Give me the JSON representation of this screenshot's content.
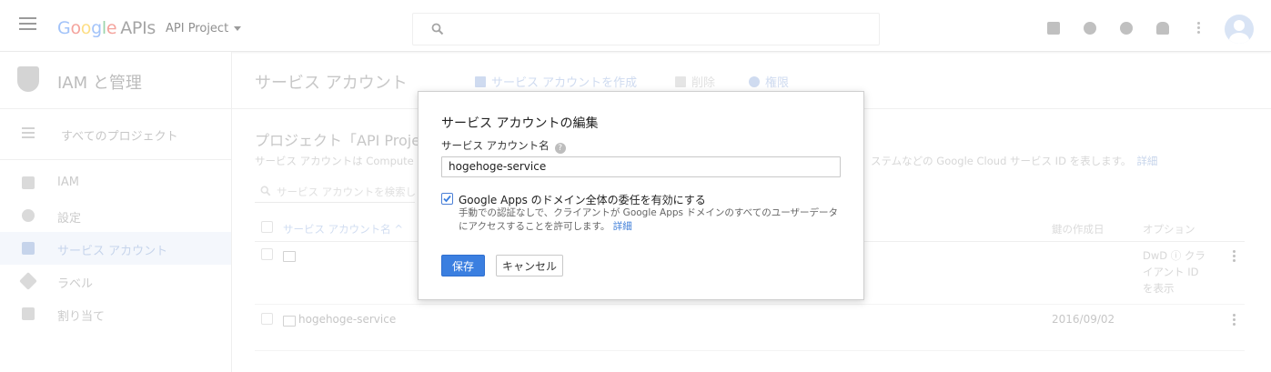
{
  "topbar": {
    "logo_google": "Google",
    "logo_apis": "APIs",
    "project": "API Project",
    "search_placeholder": ""
  },
  "sidebar": {
    "title": "IAM と管理",
    "all_projects": "すべてのプロジェクト",
    "items": [
      {
        "label": "IAM",
        "icon": "person-add-icon",
        "active": false
      },
      {
        "label": "設定",
        "icon": "gear-icon",
        "active": false
      },
      {
        "label": "サービス アカウント",
        "icon": "service-account-icon",
        "active": true
      },
      {
        "label": "ラベル",
        "icon": "label-icon",
        "active": false
      },
      {
        "label": "割り当て",
        "icon": "quota-icon",
        "active": false
      }
    ]
  },
  "main": {
    "title": "サービス アカウント",
    "actions": {
      "create": "サービス アカウントを作成",
      "delete": "削除",
      "permissions": "権限"
    },
    "section_title": "プロジェクト「API Proje",
    "section_desc_left": "サービス アカウントは Compute",
    "section_desc_right": "ステムなどの Google Cloud サービス ID を表します。",
    "section_desc_link": "詳細",
    "filter_placeholder": "サービス アカウントを検索し",
    "columns": {
      "name": "サービス アカウント名",
      "key_created": "鍵の作成日",
      "options": "オプション"
    },
    "rows": [
      {
        "name": "",
        "key_created": "",
        "option_text": "DwD ⓘ クライアント ID を表示"
      },
      {
        "name": "hogehoge-service",
        "key_created": "2016/09/02",
        "option_text": ""
      }
    ]
  },
  "dialog": {
    "title": "サービス アカウントの編集",
    "name_label": "サービス アカウント名",
    "help_glyph": "?",
    "name_value": "hogehoge-service",
    "dwd_checked": true,
    "dwd_label": "Google Apps のドメイン全体の委任を有効にする",
    "dwd_help": "手動での認証なしで、クライアントが Google Apps ドメインのすべてのユーザーデータにアクセスすることを許可します。",
    "dwd_help_link": "詳細",
    "save_label": "保存",
    "cancel_label": "キャンセル"
  },
  "colors": {
    "primary": "#3b7fe0",
    "link": "#3f7ed8",
    "sidebar_active_bg": "#eef3fb"
  }
}
